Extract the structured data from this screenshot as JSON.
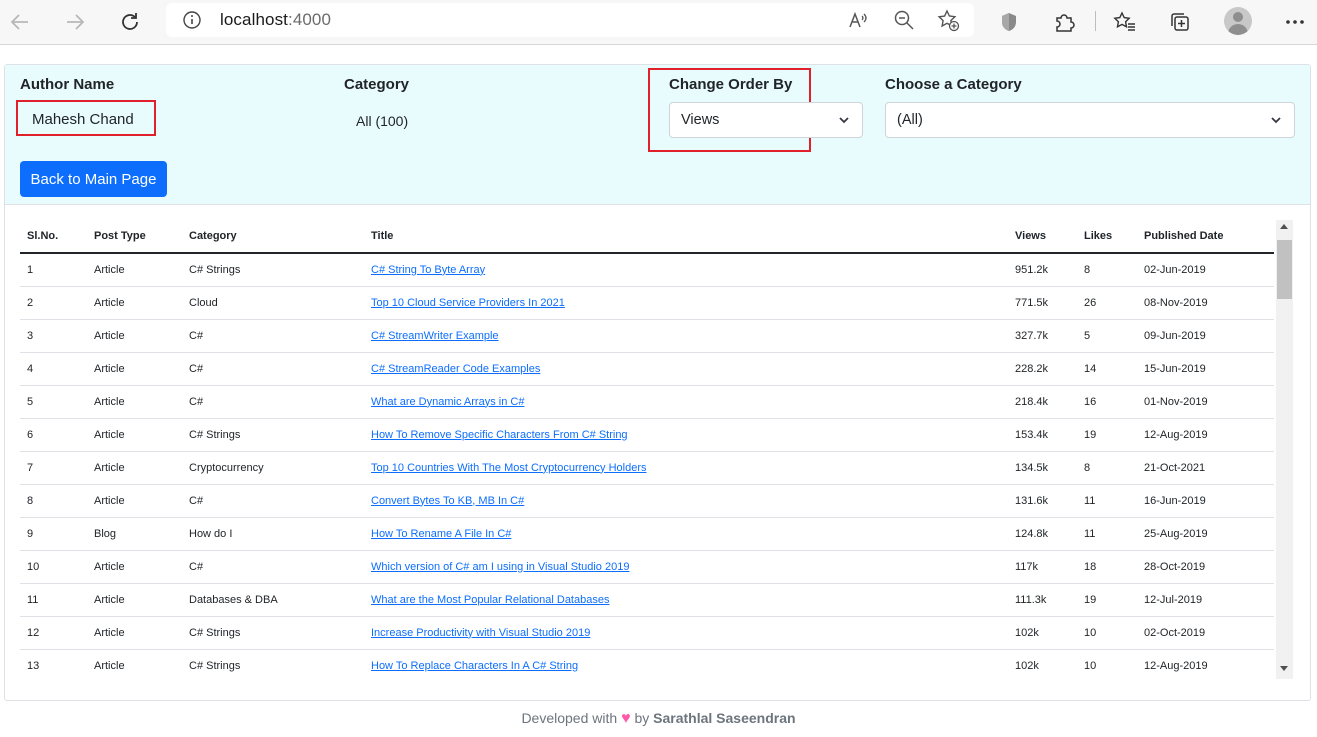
{
  "browser": {
    "url_host": "localhost",
    "url_port": ":4000"
  },
  "filters": {
    "author_label": "Author Name",
    "author_value": "Mahesh Chand",
    "category_label": "Category",
    "category_value": "All (100)",
    "order_label": "Change Order By",
    "order_value": "Views",
    "choose_category_label": "Choose a Category",
    "choose_category_value": "(All)",
    "back_button": "Back to Main Page"
  },
  "table": {
    "columns": [
      "Sl.No.",
      "Post Type",
      "Category",
      "Title",
      "Views",
      "Likes",
      "Published Date"
    ],
    "rows": [
      [
        "1",
        "Article",
        "C# Strings",
        "C# String To Byte Array",
        "951.2k",
        "8",
        "02-Jun-2019"
      ],
      [
        "2",
        "Article",
        "Cloud",
        "Top 10 Cloud Service Providers In 2021",
        "771.5k",
        "26",
        "08-Nov-2019"
      ],
      [
        "3",
        "Article",
        "C#",
        "C# StreamWriter Example",
        "327.7k",
        "5",
        "09-Jun-2019"
      ],
      [
        "4",
        "Article",
        "C#",
        "C# StreamReader Code Examples",
        "228.2k",
        "14",
        "15-Jun-2019"
      ],
      [
        "5",
        "Article",
        "C#",
        "What are Dynamic Arrays in C#",
        "218.4k",
        "16",
        "01-Nov-2019"
      ],
      [
        "6",
        "Article",
        "C# Strings",
        "How To Remove Specific Characters From C# String",
        "153.4k",
        "19",
        "12-Aug-2019"
      ],
      [
        "7",
        "Article",
        "Cryptocurrency",
        "Top 10 Countries With The Most Cryptocurrency Holders",
        "134.5k",
        "8",
        "21-Oct-2021"
      ],
      [
        "8",
        "Article",
        "C#",
        "Convert Bytes To KB, MB In C#",
        "131.6k",
        "11",
        "16-Jun-2019"
      ],
      [
        "9",
        "Blog",
        "How do I",
        "How To Rename A File In C#",
        "124.8k",
        "11",
        "25-Aug-2019"
      ],
      [
        "10",
        "Article",
        "C#",
        "Which version of C# am I using in Visual Studio 2019",
        "117k",
        "18",
        "28-Oct-2019"
      ],
      [
        "11",
        "Article",
        "Databases & DBA",
        "What are the Most Popular Relational Databases",
        "111.3k",
        "19",
        "12-Jul-2019"
      ],
      [
        "12",
        "Article",
        "C# Strings",
        "Increase Productivity with Visual Studio 2019",
        "102k",
        "10",
        "02-Oct-2019"
      ],
      [
        "13",
        "Article",
        "C# Strings",
        "How To Replace Characters In A C# String",
        "102k",
        "10",
        "12-Aug-2019"
      ]
    ]
  },
  "footer": {
    "prefix": "Developed with",
    "heart": "♥",
    "by": "by",
    "author": "Sarathlal Saseendran"
  },
  "icons": [
    "back-arrow-icon",
    "forward-arrow-icon",
    "refresh-icon",
    "info-icon",
    "read-aloud-icon",
    "zoom-out-icon",
    "add-favorite-icon",
    "shield-icon",
    "extensions-icon",
    "favorites-icon",
    "collections-icon",
    "profile-avatar-icon",
    "more-menu-icon",
    "chevron-down-icon",
    "heart-icon"
  ],
  "colors": {
    "accent": "#0d6efd",
    "highlight_border": "#e0202a",
    "filter_panel_bg": "#e9fcfd",
    "heart": "#ff5aa8"
  }
}
